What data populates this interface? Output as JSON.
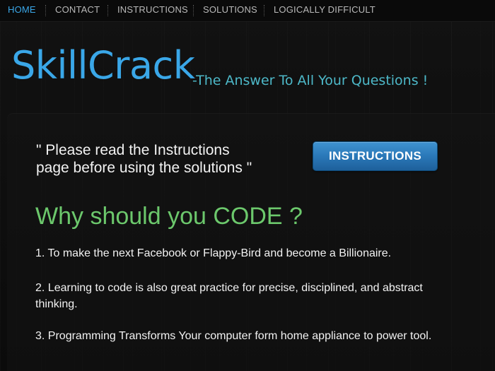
{
  "nav": {
    "items": [
      {
        "label": "HOME",
        "active": true
      },
      {
        "label": "CONTACT",
        "active": false
      },
      {
        "label": "INSTRUCTIONS",
        "active": false
      },
      {
        "label": "SOLUTIONS",
        "active": false
      },
      {
        "label": "LOGICALLY DIFFICULT",
        "active": false
      }
    ]
  },
  "header": {
    "logo": "SkillCrack",
    "tagline": "-The Answer To All Your Questions !"
  },
  "main": {
    "notice_line1": "\" Please read the Instructions",
    "notice_line2": "page before using the solutions \"",
    "instructions_button": "INSTRUCTIONS",
    "heading": "Why should you CODE ?",
    "reasons": [
      "1. To make the next Facebook or Flappy-Bird and become a Billionaire.",
      "2. Learning to code is also great practice for precise, disciplined, and abstract thinking.",
      "3. Programming Transforms Your computer form home appliance to power tool."
    ]
  },
  "colors": {
    "accent_blue": "#3aa7e8",
    "tagline_teal": "#4db8c8",
    "heading_green": "#6cc86c",
    "background": "#0d0d0d"
  }
}
